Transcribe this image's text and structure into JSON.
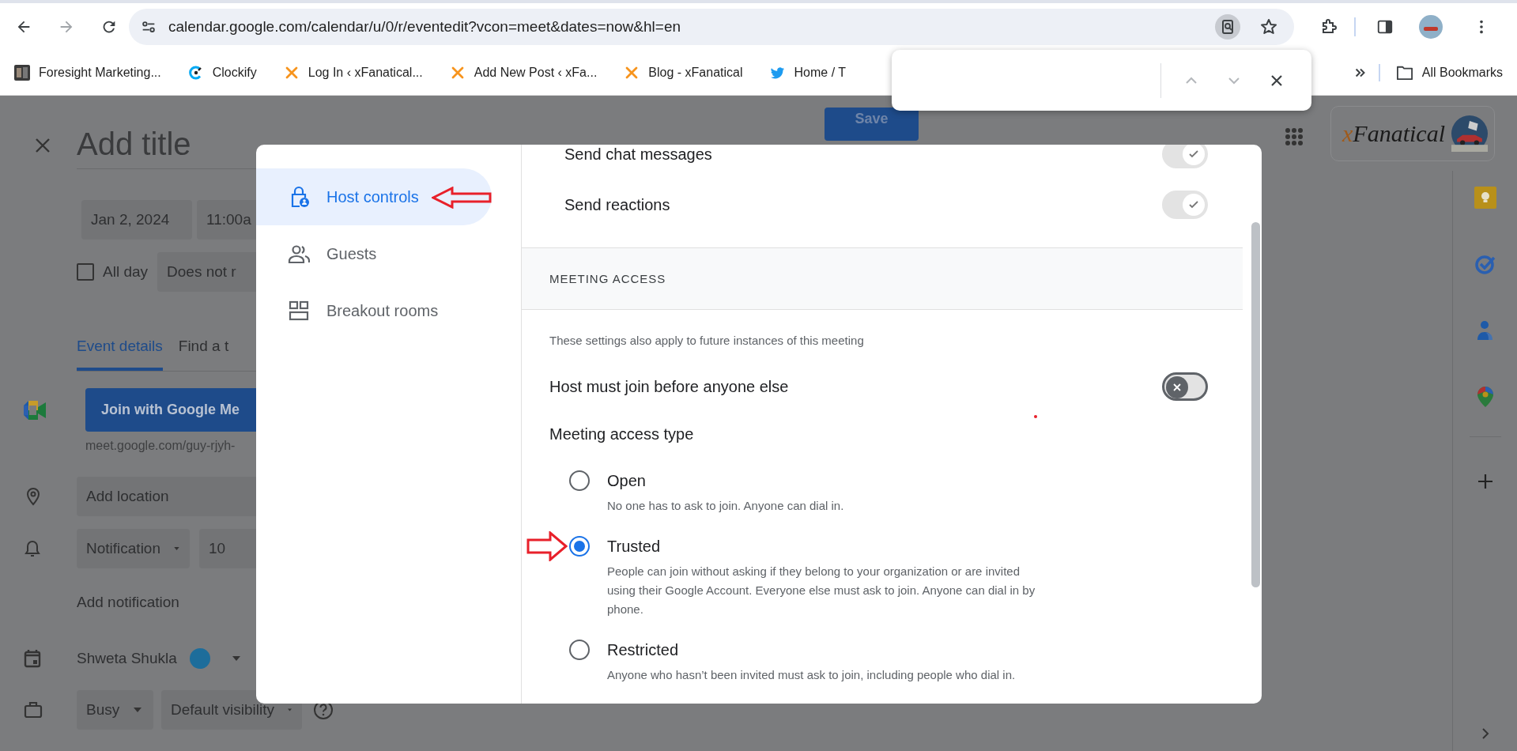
{
  "browser": {
    "url": "calendar.google.com/calendar/u/0/r/eventedit?vcon=meet&dates=now&hl=en",
    "bookmarks": [
      {
        "label": "Foresight Marketing...",
        "kind": "photo"
      },
      {
        "label": "Clockify",
        "kind": "clockify"
      },
      {
        "label": "Log In ‹ xFanatical...",
        "kind": "x"
      },
      {
        "label": "Add New Post ‹ xFa...",
        "kind": "x"
      },
      {
        "label": "Blog - xFanatical",
        "kind": "x"
      },
      {
        "label": "Home / T",
        "kind": "bird"
      }
    ],
    "all_bookmarks": "All Bookmarks"
  },
  "event": {
    "title_placeholder": "Add title",
    "save": "Save",
    "date": "Jan 2, 2024",
    "time": "11:00a",
    "all_day": {
      "label": "All day",
      "checked": false
    },
    "repeat": "Does not r",
    "tabs": [
      {
        "label": "Event details",
        "selected": true
      },
      {
        "label": "Find a t",
        "selected": false
      }
    ],
    "meet_button": "Join with Google Me",
    "meet_link": "meet.google.com/guy-rjyh-",
    "location_placeholder": "Add location",
    "notification": {
      "type": "Notification",
      "amount": "10"
    },
    "add_notification": "Add notification",
    "calendar": {
      "owner": "Shweta Shukla",
      "color": "#1d6d9b"
    },
    "availability": "Busy",
    "visibility": "Default visibility"
  },
  "logo": {
    "prefix": "x",
    "name": "Fanatical"
  },
  "dialog": {
    "nav": [
      {
        "label": "Host controls",
        "kind": "lock",
        "selected": true
      },
      {
        "label": "Guests",
        "kind": "people",
        "selected": false
      },
      {
        "label": "Breakout rooms",
        "kind": "rooms",
        "selected": false
      }
    ],
    "toggles": [
      {
        "label": "Send chat messages",
        "on": true,
        "disabled": true
      },
      {
        "label": "Send reactions",
        "on": true,
        "disabled": true
      }
    ],
    "section": "MEETING ACCESS",
    "note": "These settings also apply to future instances of this meeting",
    "host_join": {
      "label": "Host must join before anyone else",
      "on": false,
      "disabled": false
    },
    "access_type_label": "Meeting access type",
    "access_options": [
      {
        "label": "Open",
        "description": "No one has to ask to join. Anyone can dial in.",
        "selected": false
      },
      {
        "label": "Trusted",
        "description": "People can join without asking if they belong to your organization or are invited using their Google Account. Everyone else must ask to join. Anyone can dial in by phone.",
        "selected": true
      },
      {
        "label": "Restricted",
        "description": "Anyone who hasn’t been invited must ask to join, including people who dial in.",
        "selected": false
      }
    ]
  }
}
